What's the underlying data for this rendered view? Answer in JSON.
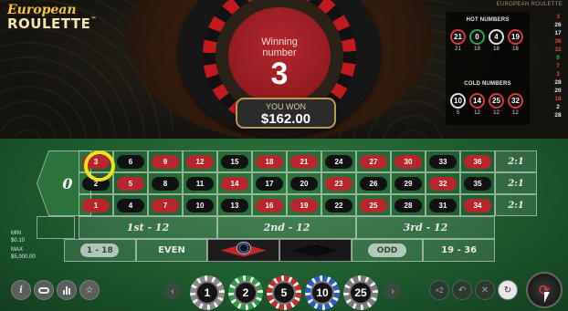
{
  "logo": {
    "line1": "European",
    "line2": "ROULETTE",
    "tm": "™"
  },
  "game_title": "EUROPEAN ROULETTE",
  "result": {
    "label_line1": "Winning",
    "label_line2": "number",
    "number": "3",
    "won_label": "YOU WON",
    "won_amount": "$162.00"
  },
  "hot_numbers": {
    "title": "HOT NUMBERS",
    "items": [
      {
        "number": "21",
        "count": "21",
        "color": "red"
      },
      {
        "number": "0",
        "count": "19",
        "color": "green"
      },
      {
        "number": "4",
        "count": "18",
        "color": "black"
      },
      {
        "number": "19",
        "count": "18",
        "color": "red"
      }
    ]
  },
  "cold_numbers": {
    "title": "COLD NUMBERS",
    "items": [
      {
        "number": "10",
        "count": "5",
        "color": "black"
      },
      {
        "number": "14",
        "count": "12",
        "color": "red"
      },
      {
        "number": "25",
        "count": "12",
        "color": "red"
      },
      {
        "number": "32",
        "count": "12",
        "color": "red"
      }
    ]
  },
  "history": [
    {
      "value": "3",
      "color": "red"
    },
    {
      "value": "26",
      "color": "black"
    },
    {
      "value": "17",
      "color": "black"
    },
    {
      "value": "36",
      "color": "red"
    },
    {
      "value": "32",
      "color": "red"
    },
    {
      "value": "0",
      "color": "green"
    },
    {
      "value": "7",
      "color": "red"
    },
    {
      "value": "3",
      "color": "red"
    },
    {
      "value": "28",
      "color": "black"
    },
    {
      "value": "20",
      "color": "black"
    },
    {
      "value": "18",
      "color": "red"
    },
    {
      "value": "2",
      "color": "black"
    },
    {
      "value": "28",
      "color": "black"
    }
  ],
  "table": {
    "zero": "0",
    "rows": [
      [
        {
          "n": "3",
          "c": "red"
        },
        {
          "n": "6",
          "c": "black"
        },
        {
          "n": "9",
          "c": "red"
        },
        {
          "n": "12",
          "c": "red"
        },
        {
          "n": "15",
          "c": "black"
        },
        {
          "n": "18",
          "c": "red"
        },
        {
          "n": "21",
          "c": "red"
        },
        {
          "n": "24",
          "c": "black"
        },
        {
          "n": "27",
          "c": "red"
        },
        {
          "n": "30",
          "c": "red"
        },
        {
          "n": "33",
          "c": "black"
        },
        {
          "n": "36",
          "c": "red"
        }
      ],
      [
        {
          "n": "2",
          "c": "black"
        },
        {
          "n": "5",
          "c": "red"
        },
        {
          "n": "8",
          "c": "black"
        },
        {
          "n": "11",
          "c": "black"
        },
        {
          "n": "14",
          "c": "red"
        },
        {
          "n": "17",
          "c": "black"
        },
        {
          "n": "20",
          "c": "black"
        },
        {
          "n": "23",
          "c": "red"
        },
        {
          "n": "26",
          "c": "black"
        },
        {
          "n": "29",
          "c": "black"
        },
        {
          "n": "32",
          "c": "red"
        },
        {
          "n": "35",
          "c": "black"
        }
      ],
      [
        {
          "n": "1",
          "c": "red"
        },
        {
          "n": "4",
          "c": "black"
        },
        {
          "n": "7",
          "c": "red"
        },
        {
          "n": "10",
          "c": "black"
        },
        {
          "n": "13",
          "c": "black"
        },
        {
          "n": "16",
          "c": "red"
        },
        {
          "n": "19",
          "c": "red"
        },
        {
          "n": "22",
          "c": "black"
        },
        {
          "n": "25",
          "c": "red"
        },
        {
          "n": "28",
          "c": "black"
        },
        {
          "n": "31",
          "c": "black"
        },
        {
          "n": "34",
          "c": "red"
        }
      ]
    ],
    "columns": [
      "2:1",
      "2:1",
      "2:1"
    ],
    "dozens": [
      "1st - 12",
      "2nd - 12",
      "3rd - 12"
    ],
    "outside": {
      "low": "1 - 18",
      "even": "EVEN",
      "odd": "ODD",
      "high": "19 - 36"
    }
  },
  "limits": {
    "min_label": "MIN",
    "min_value": "$0.10",
    "max_label": "MAX",
    "max_value": "$5,000.00"
  },
  "chips": [
    {
      "value": "1",
      "color": "#8a8a8a"
    },
    {
      "value": "2",
      "color": "#2f9a45"
    },
    {
      "value": "5",
      "color": "#c62b2b"
    },
    {
      "value": "10",
      "color": "#2a5dc4"
    },
    {
      "value": "25",
      "color": "#7a7a7a"
    }
  ],
  "controls": {
    "info": "i",
    "prev": "‹",
    "next": "›",
    "double": "×2",
    "undo": "↶",
    "clear": "✕",
    "rebet": "↻",
    "spin": "⟳"
  }
}
